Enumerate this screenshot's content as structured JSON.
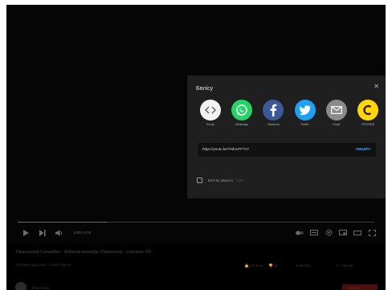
{
  "share": {
    "title": "Бөлісу",
    "close_icon": "close-icon",
    "targets": [
      {
        "id": "embed",
        "label": "Енгізу",
        "bg": "#f2f2f2",
        "icon": "embed-icon"
      },
      {
        "id": "whatsapp",
        "label": "WhatsApp",
        "bg": "#25d366",
        "icon": "whatsapp-icon"
      },
      {
        "id": "facebook",
        "label": "Facebook",
        "bg": "#3b5998",
        "icon": "facebook-icon"
      },
      {
        "id": "twitter",
        "label": "Twitter",
        "bg": "#1da1f2",
        "icon": "twitter-icon"
      },
      {
        "id": "email",
        "label": "Email",
        "bg": "#8a8a8a",
        "icon": "email-icon"
      },
      {
        "id": "kakao",
        "label": "카카오토리",
        "bg": "#ffd60a",
        "icon": "kakaostory-icon"
      }
    ],
    "url": "https://youtu.be/TNfoLPFT1Y",
    "copy_label": "КӨШІРУ",
    "start_at_label": "Бастау уақыты",
    "start_at_time": "1:23"
  },
  "player": {
    "progress_fraction": 0.25,
    "time_display": "0:00 / 4:15",
    "title": "Пашьянский Салымбек – Жібергім келмейді (Лирикалық) · Салтанат FM",
    "meta": "214 мың қаралым · 3 жыл бұрын",
    "like_count": "1,2 мың",
    "dislike_count": "48",
    "share_label": "Бөлісу",
    "save_label": "Сақтау",
    "channel": "Jibek Music",
    "subscribe_label": "Жазылу"
  },
  "colors": {
    "accent": "#3ea6ff",
    "panel": "#1f1f1f",
    "background": "#000000"
  }
}
